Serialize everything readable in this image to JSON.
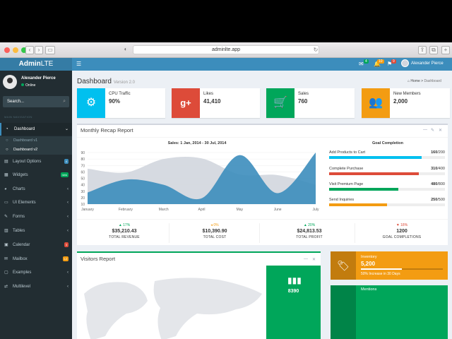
{
  "browser": {
    "url": "adminlte.app"
  },
  "header": {
    "logo_bold": "Admin",
    "logo_rest": "LTE",
    "menu_icon": "hamburger-icon",
    "notifications": [
      {
        "icon": "envelope-icon",
        "badge": "4",
        "color": "#00a65a"
      },
      {
        "icon": "bell-icon",
        "badge": "10",
        "color": "#f39c12"
      },
      {
        "icon": "flag-icon",
        "badge": "9",
        "color": "#dd4b39"
      }
    ],
    "user_name": "Alexander Pierce"
  },
  "sidebar": {
    "user_name": "Alexander Pierce",
    "status": "Online",
    "search_placeholder": "Search...",
    "section_header": "MAIN NAVIGATION",
    "items": [
      {
        "label": "Dashboard",
        "icon": "dashboard-icon",
        "active": true
      },
      {
        "label": "Layout Options",
        "icon": "files-icon",
        "badge": "4",
        "badge_color": "#3c8dbc"
      },
      {
        "label": "Widgets",
        "icon": "th-icon",
        "badge": "new",
        "badge_color": "#00a65a"
      },
      {
        "label": "Charts",
        "icon": "pie-chart-icon"
      },
      {
        "label": "UI Elements",
        "icon": "laptop-icon"
      },
      {
        "label": "Forms",
        "icon": "edit-icon"
      },
      {
        "label": "Tables",
        "icon": "table-icon"
      },
      {
        "label": "Calendar",
        "icon": "calendar-icon",
        "badge": "3",
        "badge_color": "#dd4b39"
      },
      {
        "label": "Mailbox",
        "icon": "envelope-icon",
        "badge": "12",
        "badge_color": "#f39c12"
      },
      {
        "label": "Examples",
        "icon": "folder-icon"
      },
      {
        "label": "Multilevel",
        "icon": "share-icon"
      }
    ],
    "subitems": [
      {
        "label": "Dashboard v1",
        "current": false
      },
      {
        "label": "Dashboard v2",
        "current": true
      }
    ]
  },
  "page": {
    "title": "Dashboard",
    "version": "Version 2.0",
    "breadcrumb": [
      "Home",
      "Dashboard"
    ]
  },
  "info_boxes": [
    {
      "label": "CPU Traffic",
      "value": "90%",
      "color": "#00c0ef",
      "icon": "gear-icon"
    },
    {
      "label": "Likes",
      "value": "41,410",
      "color": "#dd4b39",
      "icon": "google-plus-icon"
    },
    {
      "label": "Sales",
      "value": "760",
      "color": "#00a65a",
      "icon": "shopping-cart-icon"
    },
    {
      "label": "New Members",
      "value": "2,000",
      "color": "#f39c12",
      "icon": "users-icon"
    }
  ],
  "recap": {
    "title": "Monthly Recap Report",
    "chart_title": "Sales: 1 Jan, 2014 - 30 Jul, 2014",
    "goal_title": "Goal Completion",
    "goals": [
      {
        "label": "Add Products to Cart",
        "value": "160",
        "total": "/200",
        "fraction": 0.8,
        "color": "#00c0ef"
      },
      {
        "label": "Complete Purchase",
        "value": "310",
        "total": "/400",
        "fraction": 0.775,
        "color": "#dd4b39"
      },
      {
        "label": "Visit Premium Page",
        "value": "480",
        "total": "/800",
        "fraction": 0.6,
        "color": "#00a65a"
      },
      {
        "label": "Send Inquiries",
        "value": "250",
        "total": "/500",
        "fraction": 0.5,
        "color": "#f39c12"
      }
    ],
    "footer": [
      {
        "pct": "▲ 17%",
        "pct_color": "#00a65a",
        "amount": "$35,210.43",
        "label": "TOTAL REVENUE"
      },
      {
        "pct": "◂ 0%",
        "pct_color": "#f39c12",
        "amount": "$10,390.90",
        "label": "TOTAL COST"
      },
      {
        "pct": "▲ 20%",
        "pct_color": "#00a65a",
        "amount": "$24,813.53",
        "label": "TOTAL PROFIT"
      },
      {
        "pct": "▼ 18%",
        "pct_color": "#dd4b39",
        "amount": "1200",
        "label": "GOAL COMPLETIONS"
      }
    ]
  },
  "visitors": {
    "title": "Visitors Report",
    "green_value": "8390",
    "green_icon": "bar-chart-icon"
  },
  "inventory": {
    "label": "Inventory",
    "value": "5,200",
    "progress": 0.5,
    "desc": "50% Increase in 30 Days",
    "icon": "tag-icon"
  },
  "mentions": {
    "label": "Mentions"
  },
  "chart_data": {
    "type": "area",
    "title": "Sales: 1 Jan, 2014 - 30 Jul, 2014",
    "categories": [
      "January",
      "February",
      "March",
      "April",
      "May",
      "June",
      "July"
    ],
    "ylim": [
      10,
      90
    ],
    "yticks": [
      "90",
      "80",
      "70",
      "60",
      "50",
      "40",
      "30",
      "20",
      "10"
    ],
    "series": [
      {
        "values": [
          65,
          59,
          80,
          81,
          56,
          55,
          40
        ],
        "color": "#d2d6de"
      },
      {
        "values": [
          28,
          48,
          40,
          19,
          86,
          27,
          90
        ],
        "color": "#3c8dbc"
      }
    ],
    "grid": true
  }
}
